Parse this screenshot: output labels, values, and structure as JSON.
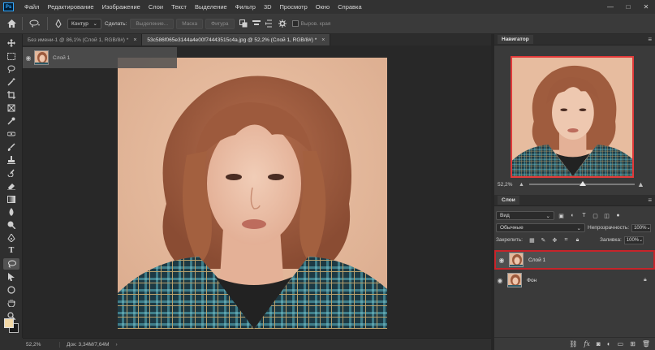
{
  "app": {
    "logo": "Ps"
  },
  "menu": [
    "Файл",
    "Редактирование",
    "Изображение",
    "Слои",
    "Текст",
    "Выделение",
    "Фильтр",
    "3D",
    "Просмотр",
    "Окно",
    "Справка"
  ],
  "window_controls": {
    "minimize": "—",
    "maximize": "□",
    "close": "✕"
  },
  "options": {
    "mode": "Контур",
    "make_label": "Сделать:",
    "selection_btn": "Выделение...",
    "mask_btn": "Маска",
    "shape_btn": "Фигура",
    "align_edges": "Выров. края"
  },
  "tabs": [
    {
      "label": "Без имени-1 @ 86,1% (Слой 1, RGB/8#) *",
      "close": "×"
    },
    {
      "label": "53c586f065e3144a4e00f74443515c4a.jpg @ 52,2% (Слой 1, RGB/8#) *",
      "close": "×"
    }
  ],
  "ghost_layer": {
    "name": "Слой 1"
  },
  "status": {
    "zoom": "52,2%",
    "doc": "Док: 3,34M/7,64M",
    "arrow": "›"
  },
  "navigator": {
    "title": "Навигатор",
    "zoom": "52,2%"
  },
  "layers_panel": {
    "title": "Слои",
    "filter": "Вид",
    "blend": "Обычные",
    "opacity_label": "Непрозрачность:",
    "opacity": "100%",
    "lock_label": "Закрепить:",
    "fill_label": "Заливка:",
    "fill": "100%",
    "layers": [
      {
        "name": "Слой 1",
        "selected": true
      },
      {
        "name": "Фон",
        "selected": false
      }
    ]
  },
  "colors": {
    "accent_selection": "#c7242a",
    "foreground": "#f3d9a7",
    "background": "#1a1a1a"
  }
}
